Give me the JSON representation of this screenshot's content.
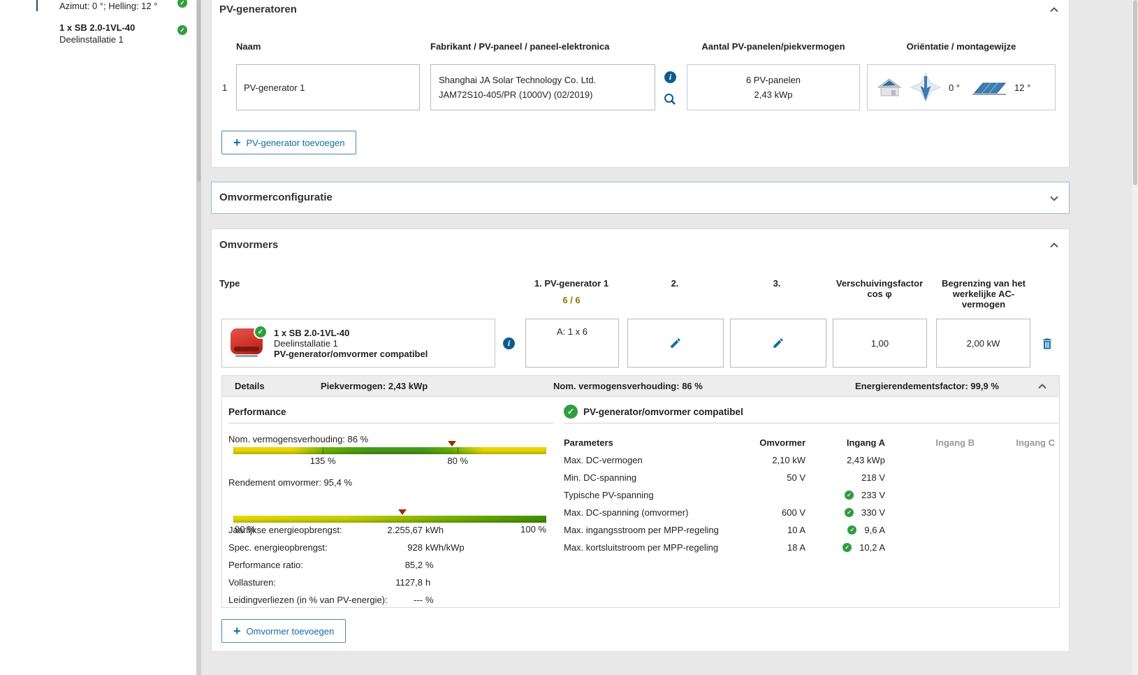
{
  "sidebar": {
    "orientation_item": {
      "label": "Azimut: 0 °; Helling: 12 °"
    },
    "inverter_item": {
      "title": "1 x SB 2.0-1VL-40",
      "subtitle": "Deelinstallatie 1"
    }
  },
  "pv_generators": {
    "title": "PV-generatoren",
    "col_name": "Naam",
    "col_manufacturer": "Fabrikant / PV-paneel / paneel-elektronica",
    "col_count": "Aantal PV-panelen/piekvermogen",
    "col_orientation": "Oriëntatie / montagewijze",
    "row_index": "1",
    "name_value": "PV-generator 1",
    "manufacturer_line1": "Shanghai JA Solar Technology Co. Ltd.",
    "manufacturer_line2": "JAM72S10-405/PR (1000V) (02/2019)",
    "panel_count": "6 PV-panelen",
    "peak_power": "2,43 kWp",
    "azimuth_value": "0 °",
    "tilt_value": "12 °",
    "add_button_label": "PV-generator toevoegen"
  },
  "inverter_configuration": {
    "title": "Omvormerconfiguratie"
  },
  "inverters": {
    "title": "Omvormers",
    "col_type": "Type",
    "col_generator1": "1. PV-generator 1",
    "generator1_allocation": "6 / 6",
    "col_slot2": "2.",
    "col_slot3": "3.",
    "col_cos_line1": "Verschuivingsfactor",
    "col_cos_line2": "cos φ",
    "col_ac_limit": "Begrenzing van het werkelijke AC-vermogen",
    "row": {
      "title": "1 x SB 2.0-1VL-40",
      "subtitle": "Deelinstallatie 1",
      "compatibility": "PV-generator/omvormer compatibel",
      "generator1_value": "A: 1 x 6",
      "cos_value": "1,00",
      "ac_limit_value": "2,00 kW"
    },
    "details": {
      "label": "Details",
      "peak_power": "Piekvermogen: 2,43 kWp",
      "power_ratio": "Nom. vermogensverhouding: 86 %",
      "energy_factor": "Energierendementsfactor: 99,9 %"
    },
    "performance": {
      "title": "Performance",
      "ratio_label": "Nom. vermogensverhouding: 86 %",
      "ratio_tick_left": "135 %",
      "ratio_tick_right": "80 %",
      "efficiency_label": "Rendement omvormer: 95,4 %",
      "efficiency_min": "90 %",
      "efficiency_max": "100 %",
      "stats": [
        {
          "label": "Jaarlijkse energieopbrengst:",
          "number": "2.255,67",
          "unit": "kWh"
        },
        {
          "label": "Spec. energieopbrengst:",
          "number": "928",
          "unit": "kWh/kWp"
        },
        {
          "label": "Performance ratio:",
          "number": "85,2",
          "unit": "%"
        },
        {
          "label": "Vollasturen:",
          "number": "1127,8",
          "unit": "h"
        },
        {
          "label": "Leidingverliezen (in % van PV-energie):",
          "number": "---",
          "unit": "%"
        }
      ]
    },
    "compatibility": {
      "title": "PV-generator/omvormer compatibel",
      "col_parameters": "Parameters",
      "col_inverter": "Omvormer",
      "col_input_a": "Ingang A",
      "col_input_b": "Ingang B",
      "col_input_c": "Ingang C",
      "rows": [
        {
          "label": "Max. DC-vermogen",
          "inverter": "2,10 kW",
          "input_a": "2,43 kWp"
        },
        {
          "label": "Min. DC-spanning",
          "inverter": "50 V",
          "input_a": "218 V"
        },
        {
          "label": "Typische PV-spanning",
          "inverter": "",
          "input_a": "233 V"
        },
        {
          "label": "Max. DC-spanning (omvormer)",
          "inverter": "600 V",
          "input_a": "330 V"
        },
        {
          "label": "Max. ingangsstroom per MPP-regeling",
          "inverter": "10 A",
          "input_a": "9,6 A"
        },
        {
          "label": "Max. kortsluitstroom per MPP-regeling",
          "inverter": "18 A",
          "input_a": "10,2 A"
        }
      ]
    },
    "add_button_label": "Omvormer toevoegen"
  },
  "colors": {
    "accent_blue": "#0f6fa3",
    "check_green": "#2f9e3f",
    "bar_yellow": "#e6d600",
    "bar_green": "#46961a",
    "marker_red": "#9b2d00"
  }
}
